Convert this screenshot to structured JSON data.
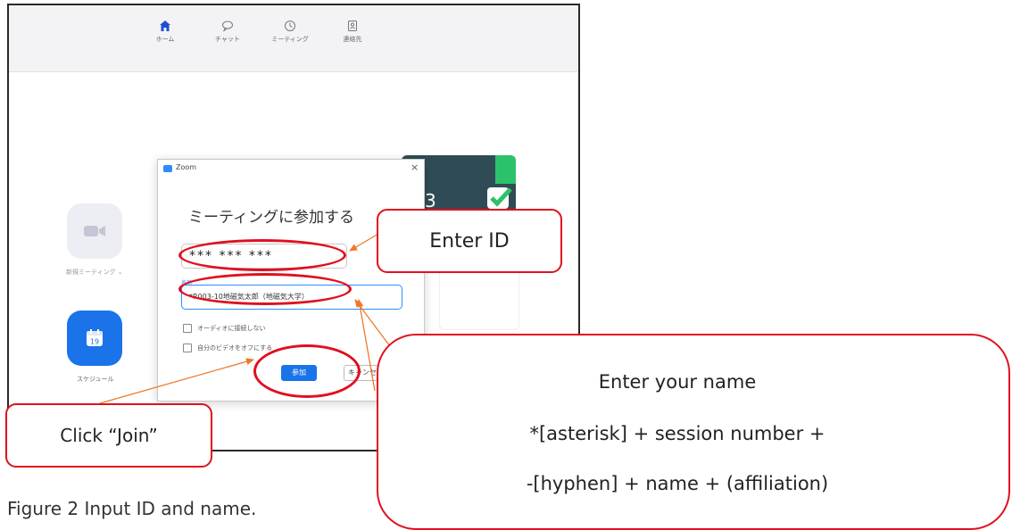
{
  "navbar": {
    "items": [
      {
        "label": "ホーム",
        "icon": "home-icon"
      },
      {
        "label": "チャット",
        "icon": "chat-icon"
      },
      {
        "label": "ミーティング",
        "icon": "clock-icon"
      },
      {
        "label": "連絡先",
        "icon": "contacts-icon"
      }
    ]
  },
  "home": {
    "new_meeting_label": "新規ミーティング ⌄",
    "schedule_label": "スケジュール",
    "schedule_date": "19",
    "panel_number": "3"
  },
  "dialog": {
    "app_name": "Zoom",
    "close": "×",
    "heading": "ミーティングに参加する",
    "meeting_id_value": "*** *** ***",
    "name_caption": "名前",
    "name_value": "*R003-10地磁気太郎（地磁気大学）",
    "option_audio": "オーディオに接続しない",
    "option_video": "自分のビデオをオフにする",
    "join_label": "参加",
    "cancel_label": "キャンセル"
  },
  "annotations": {
    "enter_id": "Enter ID",
    "click_join": "Click “Join”",
    "enter_name_title": "Enter your name",
    "enter_name_line2": "*[asterisk] + session number +",
    "enter_name_line3": "-[hyphen] + name + (affiliation)"
  },
  "caption": "Figure 2 Input ID and name.",
  "colors": {
    "highlight": "#e0101e",
    "arrow": "#ec7a2c",
    "zoom_blue": "#1a73e8"
  }
}
